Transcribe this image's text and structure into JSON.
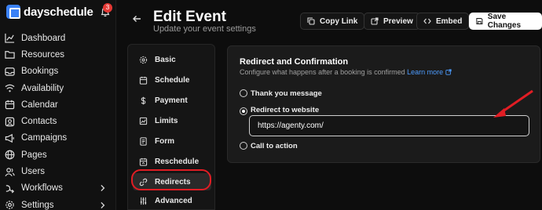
{
  "brand": {
    "name": "dayschedule",
    "notification_count": "3"
  },
  "sidebar": {
    "items": [
      {
        "label": "Dashboard",
        "icon": "chart-icon"
      },
      {
        "label": "Resources",
        "icon": "folder-icon"
      },
      {
        "label": "Bookings",
        "icon": "inbox-icon"
      },
      {
        "label": "Availability",
        "icon": "wifi-icon"
      },
      {
        "label": "Calendar",
        "icon": "calendar-icon"
      },
      {
        "label": "Contacts",
        "icon": "contact-icon"
      },
      {
        "label": "Campaigns",
        "icon": "megaphone-icon"
      },
      {
        "label": "Pages",
        "icon": "globe-icon"
      },
      {
        "label": "Users",
        "icon": "users-icon"
      },
      {
        "label": "Workflows",
        "icon": "workflow-icon",
        "has_chevron": true
      },
      {
        "label": "Settings",
        "icon": "gear-icon",
        "has_chevron": true
      }
    ]
  },
  "header": {
    "title": "Edit Event",
    "subtitle": "Update your event settings",
    "buttons": {
      "copy_link": "Copy Link",
      "preview": "Preview",
      "embed": "Embed",
      "save": "Save Changes"
    }
  },
  "event_menu": {
    "items": [
      {
        "label": "Basic",
        "icon": "settings-icon"
      },
      {
        "label": "Schedule",
        "icon": "calendar-icon"
      },
      {
        "label": "Payment",
        "icon": "dollar-icon"
      },
      {
        "label": "Limits",
        "icon": "limits-icon"
      },
      {
        "label": "Form",
        "icon": "form-icon"
      },
      {
        "label": "Reschedule",
        "icon": "reschedule-icon"
      },
      {
        "label": "Redirects",
        "icon": "link-icon",
        "active": true
      },
      {
        "label": "Advanced",
        "icon": "sliders-icon"
      }
    ]
  },
  "redirect_panel": {
    "title": "Redirect and Confirmation",
    "description": "Configure what happens after a booking is confirmed",
    "learn_more": "Learn more",
    "options": {
      "thank_you": "Thank you message",
      "redirect": "Redirect to website",
      "cta": "Call to action"
    },
    "selected": "redirect",
    "url_value": "https://agenty.com/"
  },
  "colors": {
    "accent": "#3b82f6",
    "highlight": "#e11d24",
    "link": "#4d9cff"
  }
}
